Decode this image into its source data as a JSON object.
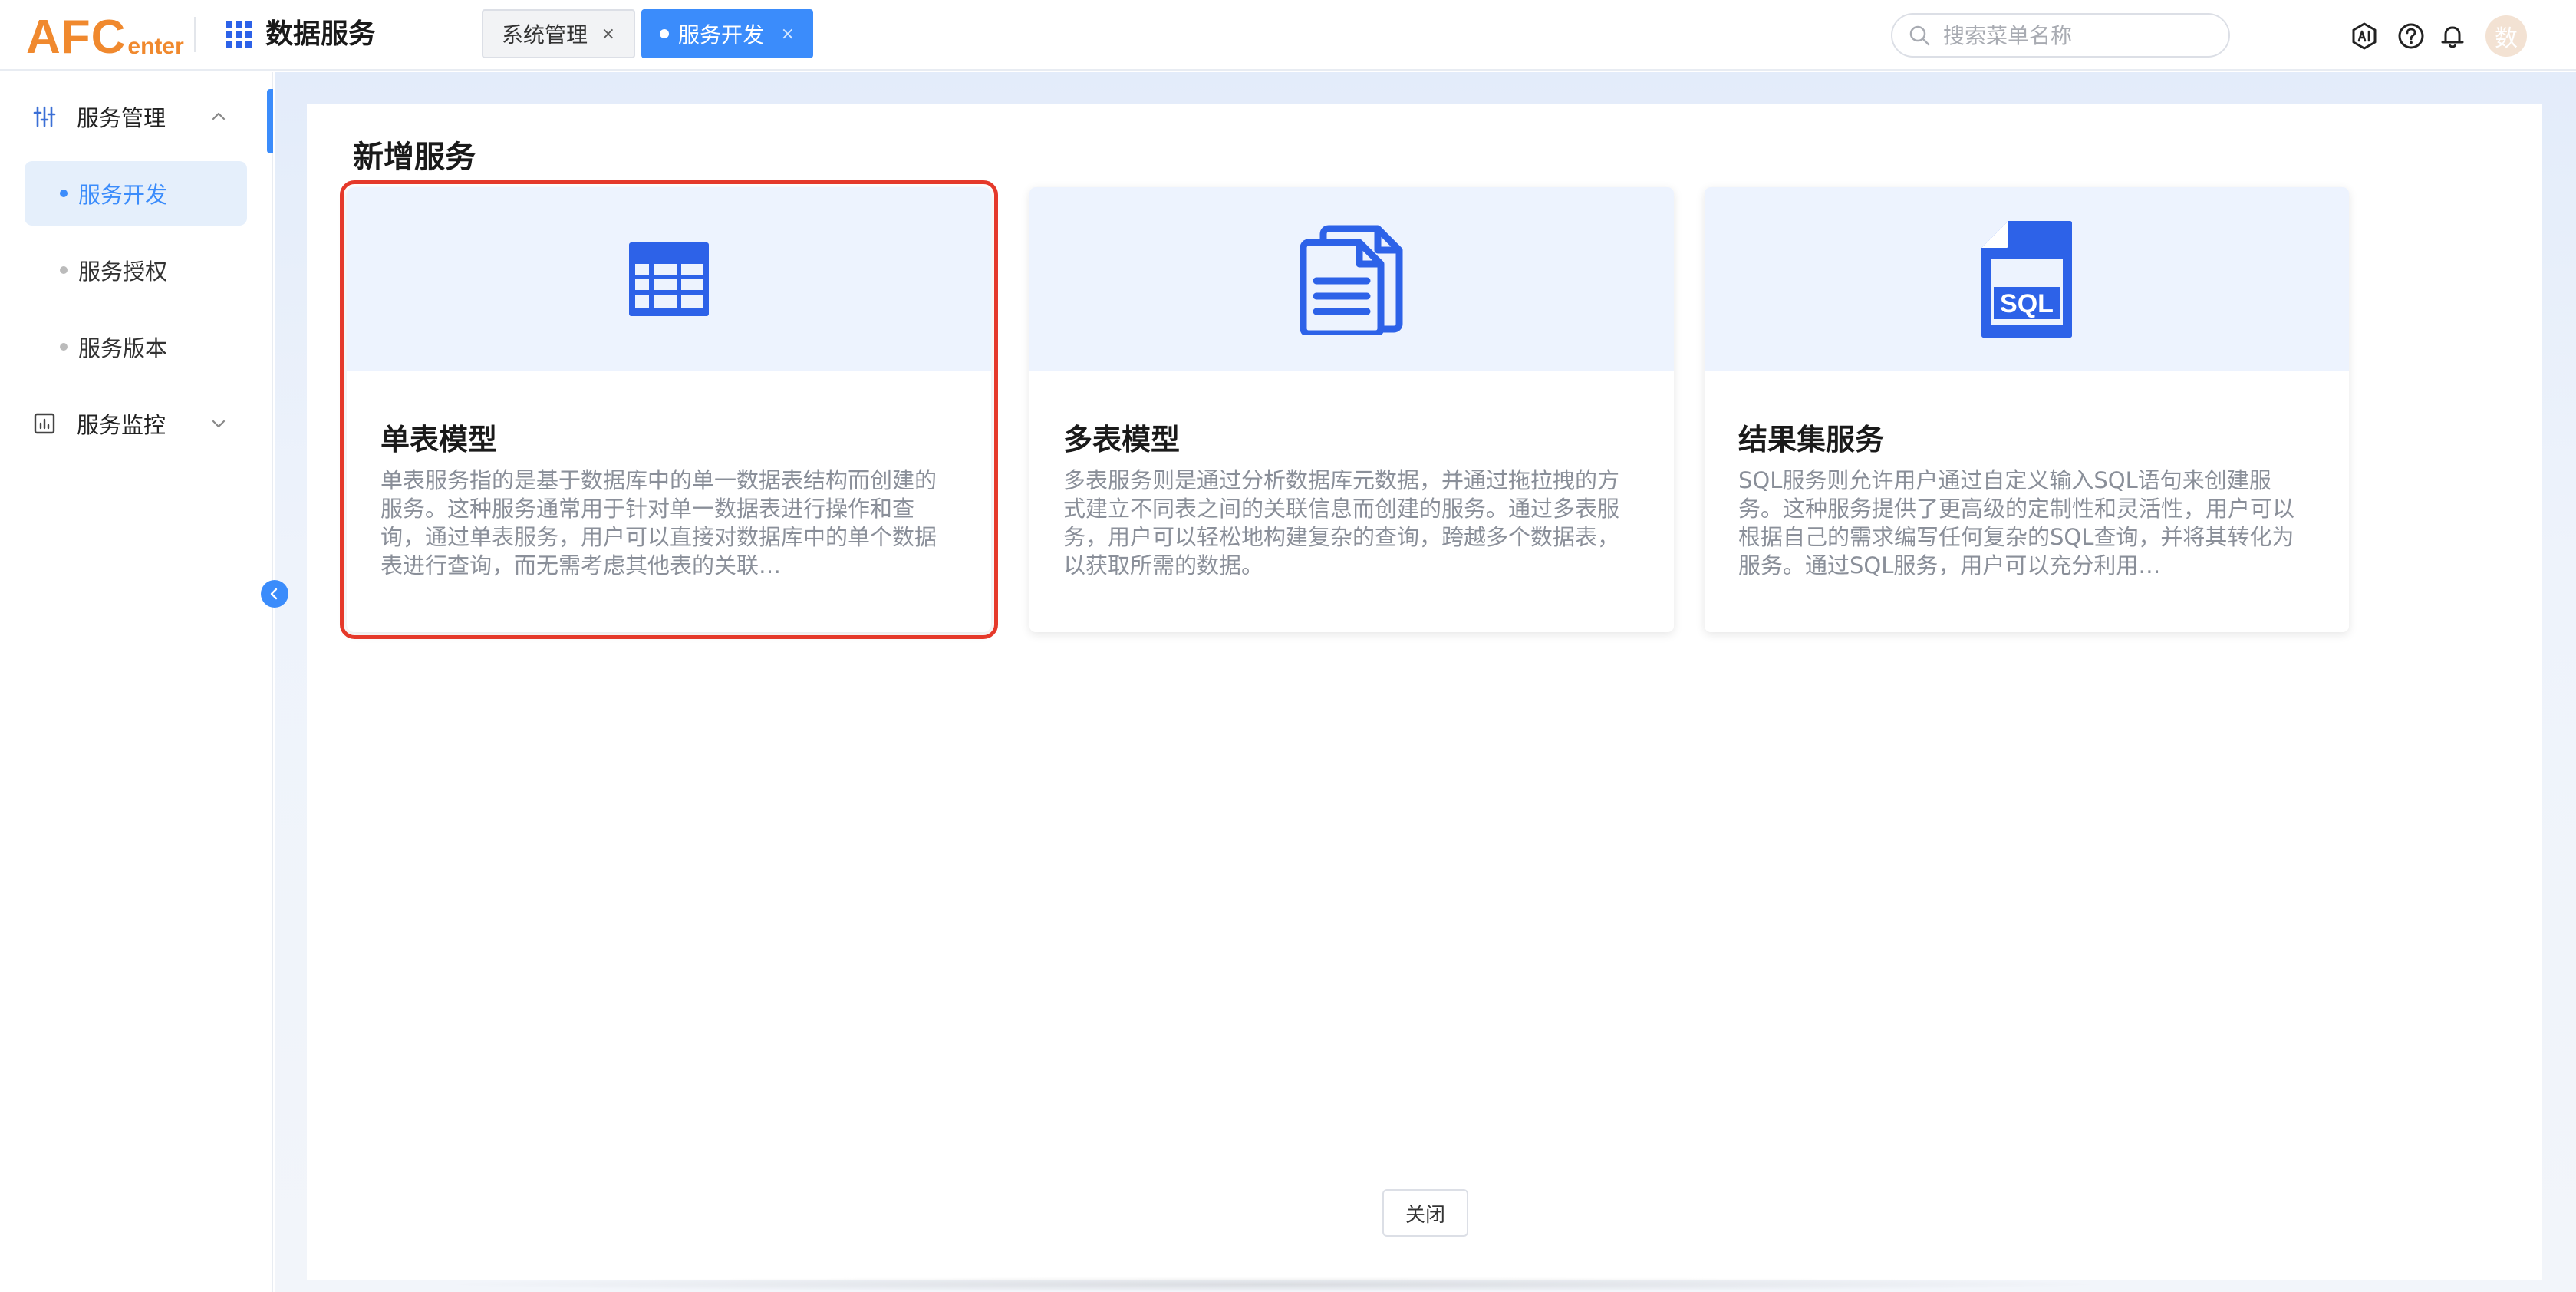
{
  "header": {
    "logo_big": "AFC",
    "logo_small": "enter",
    "app_title": "数据服务",
    "tabs": [
      {
        "label": "系统管理",
        "close": "×",
        "active": false
      },
      {
        "label": "服务开发",
        "close": "×",
        "active": true
      }
    ],
    "search_placeholder": "搜索菜单名称",
    "avatar_text": "数",
    "icons": [
      "search-icon",
      "ai-icon",
      "help-icon",
      "bell-icon"
    ]
  },
  "sidebar": {
    "groups": [
      {
        "label": "服务管理",
        "icon": "sliders-icon",
        "expanded": true,
        "items": [
          {
            "label": "服务开发",
            "active": true
          },
          {
            "label": "服务授权",
            "active": false
          },
          {
            "label": "服务版本",
            "active": false
          }
        ]
      },
      {
        "label": "服务监控",
        "icon": "chart-icon",
        "expanded": false,
        "items": []
      }
    ]
  },
  "main": {
    "title": "新增服务",
    "cards": [
      {
        "title": "单表模型",
        "icon": "table-icon",
        "selected": true,
        "description": "单表服务指的是基于数据库中的单一数据表结构而创建的服务。这种服务通常用于针对单一数据表进行操作和查询，通过单表服务，用户可以直接对数据库中的单个数据表进行查询，而无需考虑其他表的关联…"
      },
      {
        "title": "多表模型",
        "icon": "documents-icon",
        "selected": false,
        "description": "多表服务则是通过分析数据库元数据，并通过拖拉拽的方式建立不同表之间的关联信息而创建的服务。通过多表服务，用户可以轻松地构建复杂的查询，跨越多个数据表，以获取所需的数据。"
      },
      {
        "title": "结果集服务",
        "icon": "sql-file-icon",
        "selected": false,
        "icon_text": "SQL",
        "description": "SQL服务则允许用户通过自定义输入SQL语句来创建服务。这种服务提供了更高级的定制性和灵活性，用户可以根据自己的需求编写任何复杂的SQL查询，并将其转化为服务。通过SQL服务，用户可以充分利用…"
      }
    ],
    "close_label": "关闭"
  },
  "colors": {
    "accent": "#3b8cfb",
    "icon_blue": "#2d62e8",
    "selected_border": "#e5392a",
    "logo_orange": "#f0892e"
  }
}
